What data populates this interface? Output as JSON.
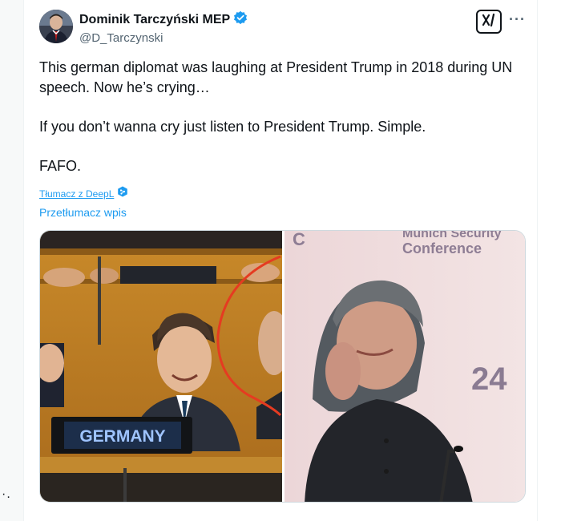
{
  "author": {
    "display_name": "Dominik Tarczyński MEP",
    "handle": "@D_Tarczynski",
    "verified": true
  },
  "tweet": {
    "paragraphs": [
      "This german diplomat was laughing at President Trump in 2018 during UN speech. Now he’s crying…",
      "If you don’t wanna cry just listen to President Trump. Simple.",
      "FAFO."
    ],
    "deepl_link": "Tłumacz z DeepL",
    "translate_link": "Przetłumacz wpis"
  },
  "media": {
    "left_image": {
      "placard": "GERMANY"
    },
    "right_image": {
      "banner_line1": "Munich Security",
      "banner_line2": "Conference",
      "backdrop_fragment_left": "C",
      "backdrop_fragment_right": "24"
    }
  },
  "icons": {
    "verified": "verified-badge-icon",
    "grok": "grok-icon",
    "more": "more-options-icon",
    "deepl": "deepl-shield-icon"
  },
  "colors": {
    "accent": "#1d9bf0",
    "text_primary": "#0f1419",
    "text_secondary": "#536471"
  },
  "ui": {
    "more_glyph": "···",
    "stray_glyph": "·."
  }
}
